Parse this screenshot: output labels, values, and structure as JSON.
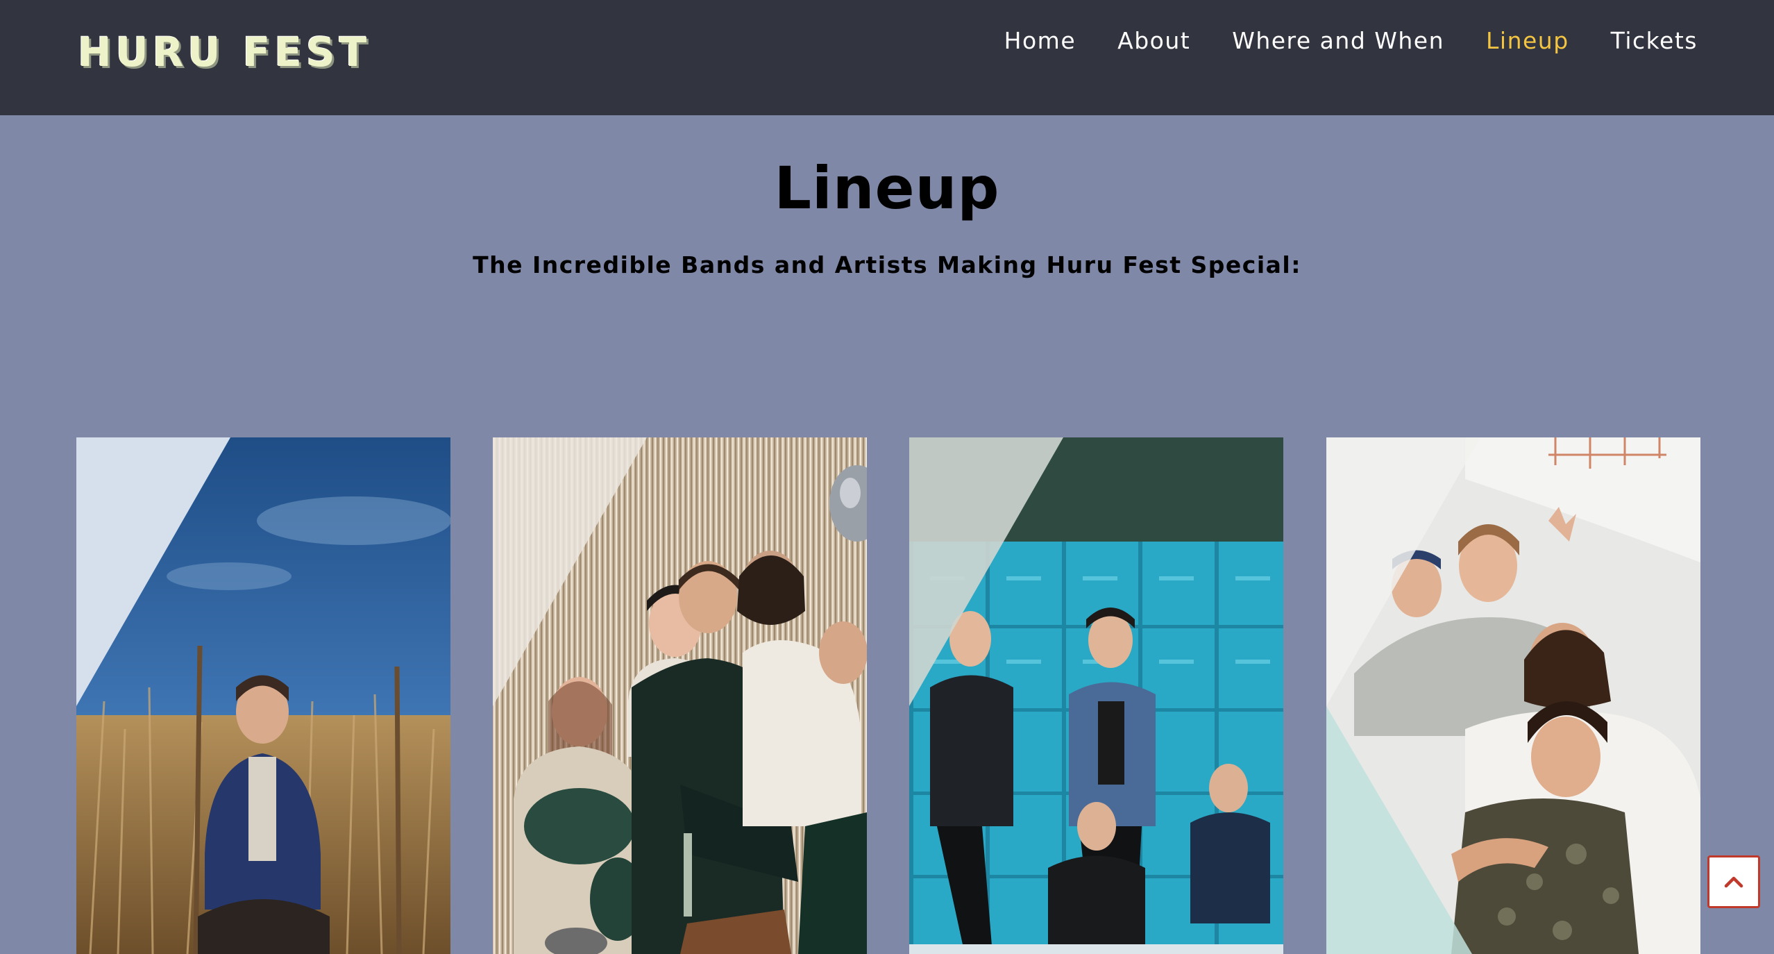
{
  "brand": {
    "logo_text": "HURU FEST"
  },
  "nav": {
    "items": [
      {
        "label": "Home",
        "active": false
      },
      {
        "label": "About",
        "active": false
      },
      {
        "label": "Where and When",
        "active": false
      },
      {
        "label": "Lineup",
        "active": true
      },
      {
        "label": "Tickets",
        "active": false
      }
    ]
  },
  "main": {
    "title": "Lineup",
    "subtitle": "The Incredible Bands and Artists Making Huru Fest Special:"
  },
  "colors": {
    "navbar_bg": "#32343f",
    "page_bg": "#8088a8",
    "nav_active": "#f4c542",
    "scroll_button_border": "#c0392b"
  },
  "lineup": [
    {
      "photo": "solo artist seated in tall dry grass under blue sky"
    },
    {
      "photo": "band of five seated against silver tinsel curtain"
    },
    {
      "photo": "band of five posing in front of turquoise lockers"
    },
    {
      "photo": "band of four laughing and hugging against white wall"
    }
  ],
  "icons": {
    "scroll_top": "chevron-up-icon"
  }
}
